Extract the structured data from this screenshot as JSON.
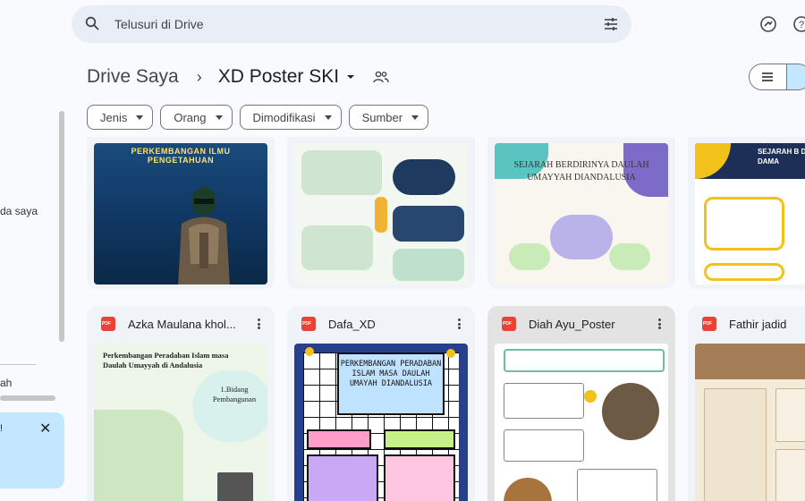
{
  "search": {
    "placeholder": "Telusuri di Drive"
  },
  "sidebar": {
    "partial_item": "da saya",
    "partial_storage": "ah",
    "banner_mark": "!"
  },
  "breadcrumb": {
    "root": "Drive Saya",
    "separator": "›",
    "current": "XD Poster SKI"
  },
  "filters": [
    {
      "label": "Jenis"
    },
    {
      "label": "Orang"
    },
    {
      "label": "Dimodifikasi"
    },
    {
      "label": "Sumber"
    }
  ],
  "files": [
    {
      "name": "Azka Maulana khol..."
    },
    {
      "name": "Dafa_XD"
    },
    {
      "name": "Diah Ayu_Poster"
    },
    {
      "name": "Fathir jadid"
    }
  ],
  "thumb_text": {
    "p1_title": "PERKEMBANGAN ILMU PENGETAHUAN",
    "p3_title": "SEJARAH BERDIRINYA DAULAH UMAYYAH DIANDALUSIA",
    "p4_title": "SEJARAH B DAULAH UM DAMA",
    "p5_title": "Perkembangan Peradaban Islam masa Daulah Umayyah di Andalusia",
    "p5_sub": "1.Bidang Pembangunan",
    "p6_title": "PERKEMBANGAN PERADABAN ISLAM MASA DAULAH UMAYAH DIANDALUSIA"
  }
}
